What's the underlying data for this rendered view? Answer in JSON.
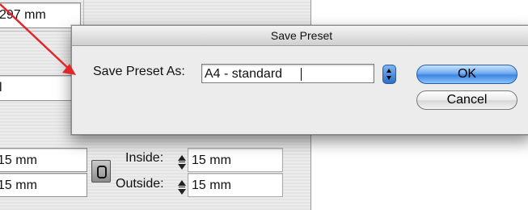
{
  "background": {
    "page_height_value": "297 mm",
    "partial_field_text": "l",
    "margin_left_top": "15 mm",
    "margin_left_bottom": "15 mm",
    "inside_label": "Inside:",
    "inside_value": "15 mm",
    "outside_label": "Outside:",
    "outside_value": "15 mm",
    "chain_icon": "chain-link-icon"
  },
  "dialog": {
    "title": "Save Preset",
    "label": "Save Preset As:",
    "preset_name": "A4 - standard",
    "ok_label": "OK",
    "cancel_label": "Cancel",
    "accent_color": "#3d86e0"
  },
  "annotation": {
    "arrow_color": "#e0262b"
  }
}
